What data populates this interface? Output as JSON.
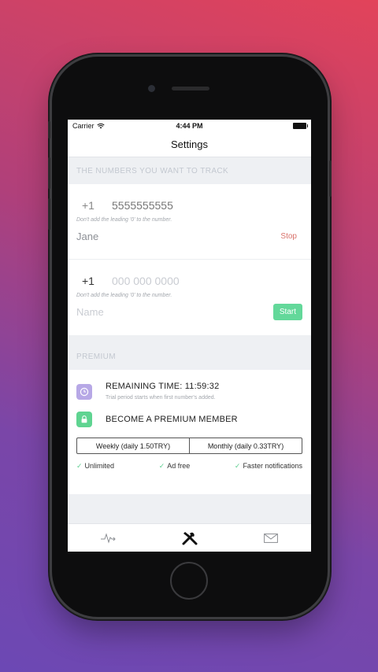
{
  "status": {
    "carrier": "Carrier",
    "time": "4:44 PM"
  },
  "nav": {
    "title": "Settings"
  },
  "tracking": {
    "section_title": "THE NUMBERS YOU WANT TO TRACK",
    "entries": [
      {
        "country_code": "+1",
        "number": "5555555555",
        "hint": "Don't add the leading '0' to the number.",
        "name": "Jane",
        "action": "Stop"
      },
      {
        "country_code": "+1",
        "number_placeholder": "000 000 0000",
        "hint": "Don't add the leading '0' to the number.",
        "name_placeholder": "Name",
        "action": "Start"
      }
    ]
  },
  "premium": {
    "section_title": "PREMIUM",
    "remaining_title": "REMAINING TIME: 11:59:32",
    "remaining_sub": "Trial period starts when first number's added.",
    "become_title": "BECOME A PREMIUM MEMBER",
    "plans": [
      "Weekly (daily 1.50TRY)",
      "Monthly (daily 0.33TRY)"
    ],
    "features": [
      "Unlimited",
      "Ad free",
      "Faster notifications"
    ]
  },
  "tabs": [
    {
      "icon": "activity-icon",
      "active": false
    },
    {
      "icon": "tools-icon",
      "active": true
    },
    {
      "icon": "mail-icon",
      "active": false
    }
  ],
  "colors": {
    "accent_green": "#5fd491",
    "stop_red": "#d9726b",
    "clock_purple": "#b7a8e6"
  }
}
